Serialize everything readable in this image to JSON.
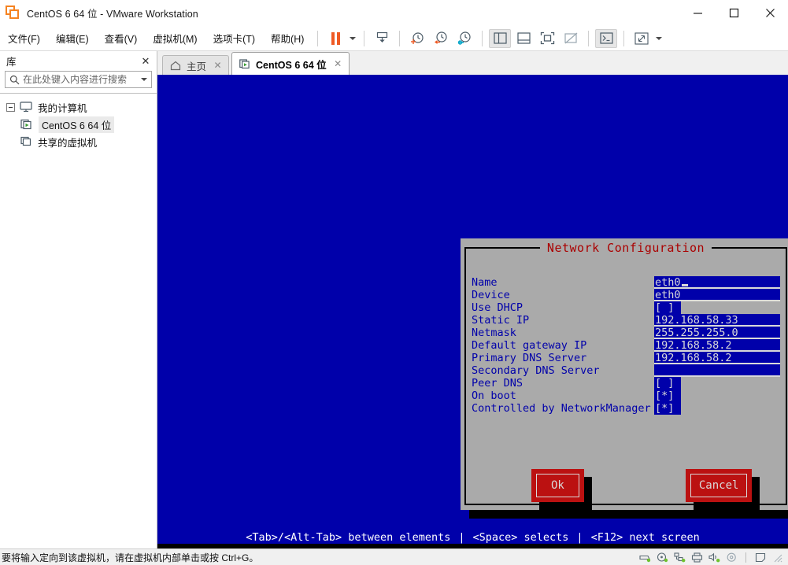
{
  "window": {
    "title": "CentOS 6 64 位 - VMware Workstation",
    "app_icon": "vmware-logo-icon",
    "controls": {
      "minimize": "minimize-icon",
      "maximize": "maximize-icon",
      "close": "close-icon"
    }
  },
  "menubar": {
    "items": [
      {
        "label": "文件(F)",
        "accel": "F"
      },
      {
        "label": "编辑(E)",
        "accel": "E"
      },
      {
        "label": "查看(V)",
        "accel": "V"
      },
      {
        "label": "虚拟机(M)",
        "accel": "M"
      },
      {
        "label": "选项卡(T)",
        "accel": "T"
      },
      {
        "label": "帮助(H)",
        "accel": "H"
      }
    ],
    "toolbar": [
      {
        "name": "pause-button",
        "icon": "pause-icon"
      },
      {
        "name": "power-dropdown",
        "icon": "chevron-down-icon"
      },
      {
        "name": "snapshot-manager-button",
        "icon": "snapshot-save-icon"
      },
      {
        "name": "take-snapshot-button",
        "icon": "clock-plus-icon"
      },
      {
        "name": "revert-snapshot-button",
        "icon": "clock-back-icon"
      },
      {
        "name": "manage-snapshots-button",
        "icon": "clock-settings-icon"
      },
      {
        "name": "show-library-button",
        "icon": "sidebar-panel-icon",
        "active": true
      },
      {
        "name": "show-thumbnail-bar-button",
        "icon": "bottom-panel-icon"
      },
      {
        "name": "fullscreen-button",
        "icon": "fullscreen-icon"
      },
      {
        "name": "unity-mode-button",
        "icon": "unity-mode-icon"
      },
      {
        "name": "console-button",
        "icon": "terminal-icon",
        "active": true
      },
      {
        "name": "stretch-button",
        "icon": "expand-diagonal-icon"
      },
      {
        "name": "stretch-dropdown",
        "icon": "chevron-down-icon"
      }
    ]
  },
  "sidebar": {
    "title": "库",
    "close_icon": "close-icon",
    "search": {
      "placeholder": "在此处键入内容进行搜索",
      "value": "",
      "icon": "search-icon",
      "dropdown_icon": "chevron-down-icon"
    },
    "tree": [
      {
        "label": "我的计算机",
        "icon": "monitor-icon",
        "indent": 0,
        "expander": true,
        "selected": false
      },
      {
        "label": "CentOS 6 64 位",
        "icon": "vm-running-icon",
        "indent": 1,
        "expander": false,
        "selected": true
      },
      {
        "label": "共享的虚拟机",
        "icon": "shared-vm-icon",
        "indent": 0,
        "expander": false,
        "selected": false
      }
    ]
  },
  "tabs": [
    {
      "label": "主页",
      "icon": "home-icon",
      "active": false,
      "close_icon": "close-icon"
    },
    {
      "label": "CentOS 6 64 位",
      "icon": "vm-running-icon",
      "active": true,
      "close_icon": "close-icon"
    }
  ],
  "vm_console": {
    "background_color": "#0000aa",
    "dialog": {
      "title": "Network Configuration",
      "title_color": "#aa0000",
      "background_color": "#aaaaaa",
      "field_color": "#0000aa",
      "fields": [
        {
          "label": "Name",
          "value": "eth0",
          "type": "text",
          "cursor": true
        },
        {
          "label": "Device",
          "value": "eth0",
          "type": "text",
          "cursor": false
        },
        {
          "label": "Use DHCP",
          "value": "[ ]",
          "type": "checkbox",
          "checked": false
        },
        {
          "label": "Static IP",
          "value": "192.168.58.33",
          "type": "text",
          "cursor": false
        },
        {
          "label": "Netmask",
          "value": "255.255.255.0",
          "type": "text",
          "cursor": false
        },
        {
          "label": "Default gateway IP",
          "value": "192.168.58.2",
          "type": "text",
          "cursor": false
        },
        {
          "label": "Primary DNS Server",
          "value": "192.168.58.2",
          "type": "text",
          "cursor": false
        },
        {
          "label": "Secondary DNS Server",
          "value": "",
          "type": "text",
          "cursor": false
        },
        {
          "label": "Peer DNS",
          "value": "[ ]",
          "type": "checkbox",
          "checked": false
        },
        {
          "label": "On boot",
          "value": "[*]",
          "type": "checkbox",
          "checked": true
        },
        {
          "label": "Controlled by NetworkManager",
          "value": "[*]",
          "type": "checkbox",
          "checked": true
        }
      ],
      "buttons": [
        {
          "label": "Ok",
          "color": "#bb1111"
        },
        {
          "label": "Cancel",
          "color": "#bb1111"
        }
      ]
    },
    "help_bar": {
      "hint1": "<Tab>/<Alt-Tab> between elements",
      "sep1": "|",
      "hint2": "<Space> selects",
      "sep2": "|",
      "hint3": "<F12> next screen"
    }
  },
  "statusbar": {
    "message": "要将输入定向到该虚拟机，请在虚拟机内部单击或按 Ctrl+G。",
    "icons": [
      {
        "name": "hard-disk-icon"
      },
      {
        "name": "cd-dvd-icon"
      },
      {
        "name": "network-adapter-icon"
      },
      {
        "name": "printer-icon"
      },
      {
        "name": "sound-card-icon"
      },
      {
        "name": "optical-drive-icon"
      }
    ]
  }
}
